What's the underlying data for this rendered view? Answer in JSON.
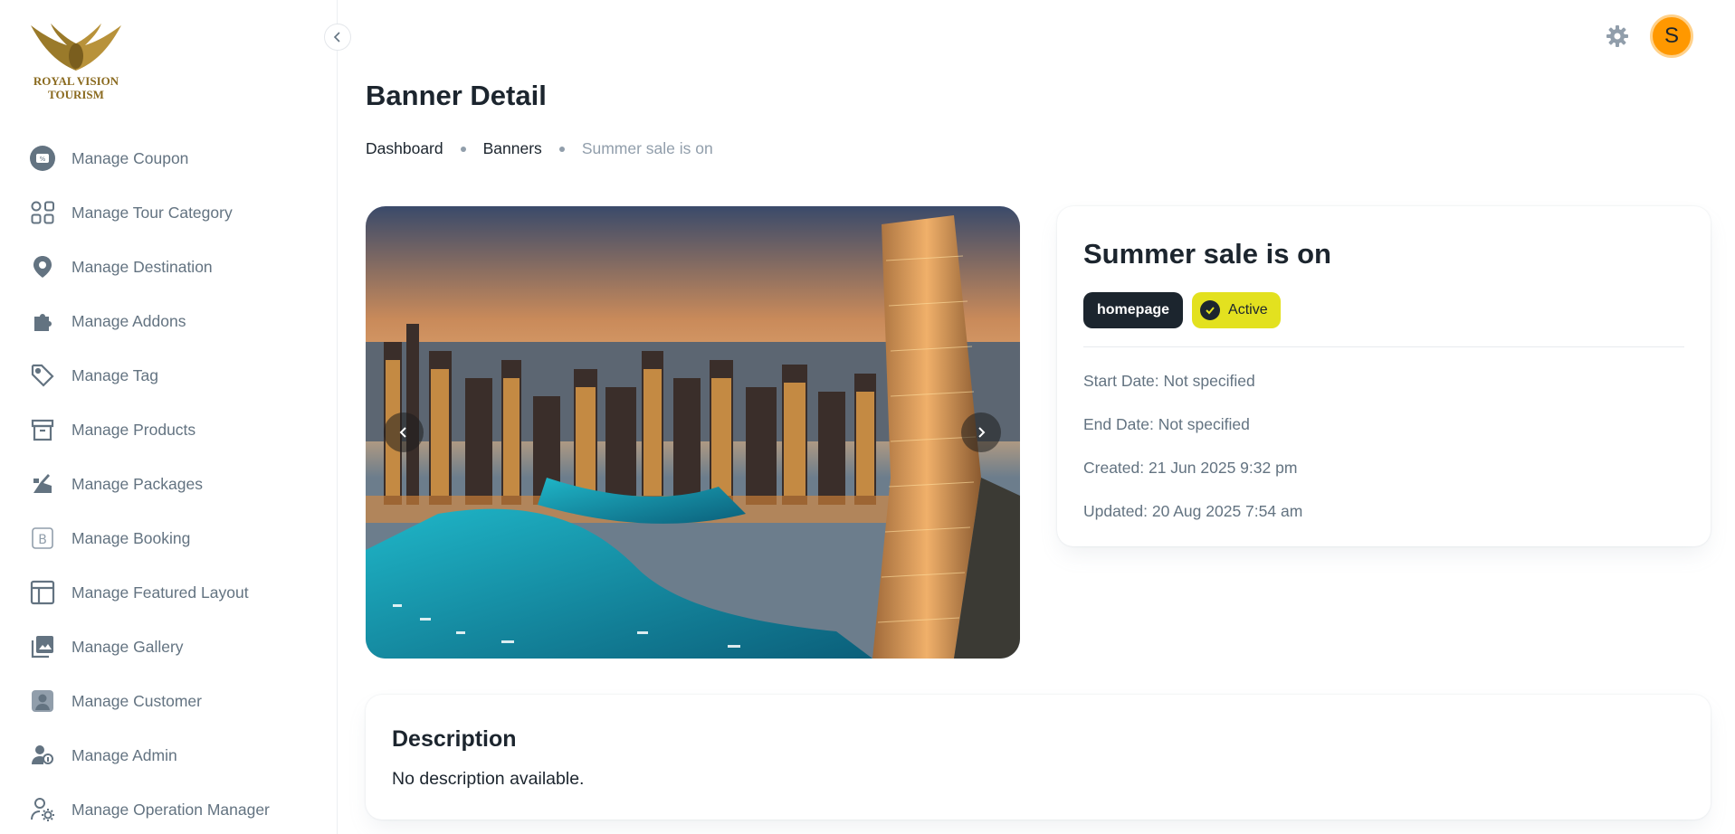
{
  "brand": {
    "logo_text_line1": "ROYAL VISION",
    "logo_text_line2": "TOURISM"
  },
  "sidebar": {
    "items": [
      {
        "label": "Manage Coupon",
        "icon": "coupon-icon"
      },
      {
        "label": "Manage Tour Category",
        "icon": "category-icon"
      },
      {
        "label": "Manage Destination",
        "icon": "location-pin-icon"
      },
      {
        "label": "Manage Addons",
        "icon": "puzzle-icon"
      },
      {
        "label": "Manage Tag",
        "icon": "tag-icon"
      },
      {
        "label": "Manage Products",
        "icon": "archive-box-icon"
      },
      {
        "label": "Manage Packages",
        "icon": "packages-icon"
      },
      {
        "label": "Manage Booking",
        "icon": "booking-icon"
      },
      {
        "label": "Manage Featured Layout",
        "icon": "layout-icon"
      },
      {
        "label": "Manage Gallery",
        "icon": "gallery-icon"
      },
      {
        "label": "Manage Customer",
        "icon": "customer-icon"
      },
      {
        "label": "Manage Admin",
        "icon": "admin-icon"
      },
      {
        "label": "Manage Operation Manager",
        "icon": "user-gear-icon"
      }
    ]
  },
  "header": {
    "avatar_initial": "S"
  },
  "page": {
    "title": "Banner Detail",
    "breadcrumb": {
      "item1": "Dashboard",
      "item2": "Banners",
      "current": "Summer sale is on"
    }
  },
  "banner": {
    "title": "Summer sale is on",
    "placement_chip": "homepage",
    "status_chip": "Active",
    "start_date": "Start Date: Not specified",
    "end_date": "End Date: Not specified",
    "created": "Created: 21 Jun 2025 9:32 pm",
    "updated": "Updated: 20 Aug 2025 7:54 am"
  },
  "description": {
    "heading": "Description",
    "text": "No description available."
  },
  "colors": {
    "accent_active": "#e3e11f",
    "avatar": "#ff9800",
    "chip_dark": "#1c252e"
  }
}
